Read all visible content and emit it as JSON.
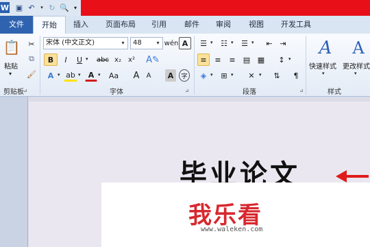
{
  "titlebar": {
    "accent_color": "#e80f18"
  },
  "tabs": [
    {
      "label": "文件"
    },
    {
      "label": "开始"
    },
    {
      "label": "插入"
    },
    {
      "label": "页面布局"
    },
    {
      "label": "引用"
    },
    {
      "label": "邮件"
    },
    {
      "label": "审阅"
    },
    {
      "label": "视图"
    },
    {
      "label": "开发工具"
    }
  ],
  "ribbon": {
    "clipboard": {
      "paste_label": "粘贴",
      "group_label": "剪贴板"
    },
    "font": {
      "font_name": "宋体 (中文正文)",
      "font_size": "48",
      "group_label": "字体",
      "bold": "B",
      "italic": "I",
      "underline": "U",
      "strike": "abc",
      "sub": "x₂",
      "sup": "x²",
      "grow": "A",
      "shrink": "A",
      "case": "Aa",
      "char_border": "A",
      "phonetic": "wén",
      "clear": "A"
    },
    "paragraph": {
      "group_label": "段落"
    },
    "styles": {
      "quick_styles": "快速样式",
      "change_styles": "更改样式",
      "group_label": "样式"
    }
  },
  "document": {
    "title": "毕业论文"
  },
  "watermark": {
    "logo_text": "我乐看",
    "url": "www.waleken.com"
  }
}
